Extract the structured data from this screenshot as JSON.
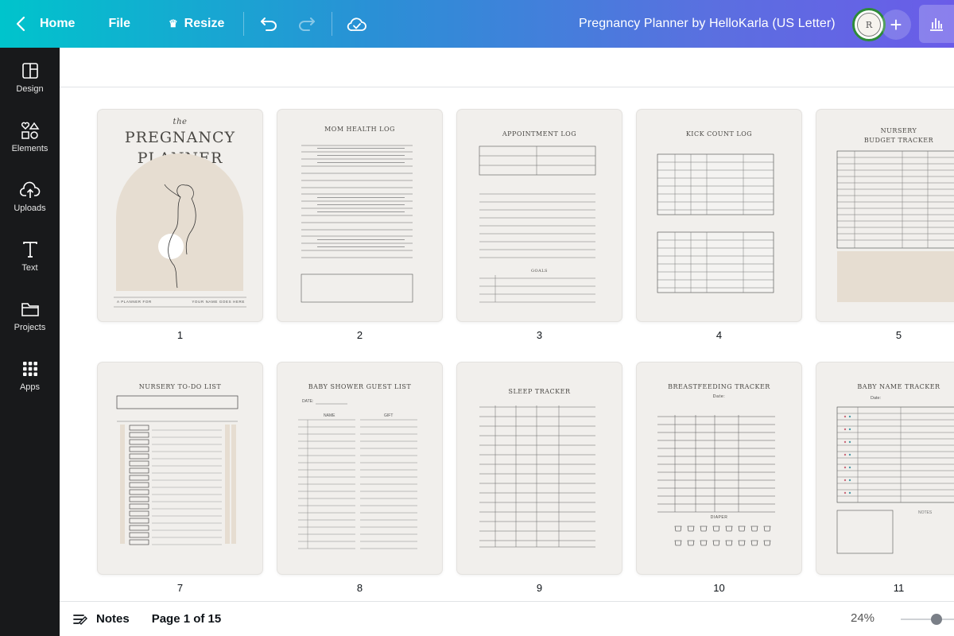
{
  "topbar": {
    "home_label": "Home",
    "file_label": "File",
    "resize_label": "Resize",
    "doc_title": "Pregnancy Planner by HelloKarla (US Letter)",
    "avatar_text": "R"
  },
  "sidebar": {
    "items": [
      {
        "label": "Design",
        "icon": "layout-icon"
      },
      {
        "label": "Elements",
        "icon": "shapes-icon"
      },
      {
        "label": "Uploads",
        "icon": "cloud-upload-icon"
      },
      {
        "label": "Text",
        "icon": "text-icon"
      },
      {
        "label": "Projects",
        "icon": "folder-icon"
      },
      {
        "label": "Apps",
        "icon": "grid-icon"
      }
    ]
  },
  "pages": [
    {
      "number": "1",
      "title": [
        "the",
        "PREGNANCY",
        "PLANNER"
      ],
      "footer_left": "A PLANNER FOR",
      "footer_right": "YOUR NAME GOES HERE"
    },
    {
      "number": "2",
      "title": "MOM HEALTH LOG"
    },
    {
      "number": "3",
      "title": "APPOINTMENT LOG",
      "subtitle": "GOALS"
    },
    {
      "number": "4",
      "title": "KICK COUNT LOG"
    },
    {
      "number": "5",
      "title": [
        "NURSERY",
        "BUDGET TRACKER"
      ]
    },
    {
      "number": "7",
      "title": "NURSERY TO-DO LIST"
    },
    {
      "number": "8",
      "title": "BABY SHOWER GUEST LIST",
      "col1": "NAME",
      "col2": "GIFT",
      "date_label": "DATE:"
    },
    {
      "number": "9",
      "title": "SLEEP TRACKER"
    },
    {
      "number": "10",
      "title": "BREASTFEEDING TRACKER",
      "date_label": "Date:",
      "diaper_label": "DIAPER"
    },
    {
      "number": "11",
      "title": "BABY NAME TRACKER",
      "date_label": "Date:",
      "notes_label": "NOTES"
    }
  ],
  "bottombar": {
    "notes_label": "Notes",
    "page_info": "Page 1 of 15",
    "zoom": "24%"
  },
  "colors": {
    "gradient_start": "#00c4cc",
    "gradient_end": "#6a5ce8",
    "sidebar_bg": "#18191b",
    "page_bg": "#f1efec",
    "arch_beige": "#e6ddd1"
  }
}
